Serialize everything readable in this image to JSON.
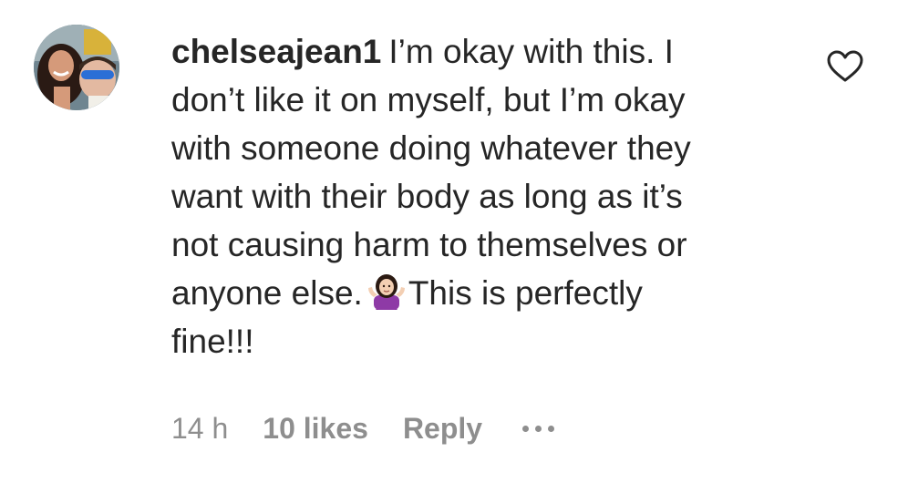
{
  "comment": {
    "username": "chelseajean1",
    "text_lines": [
      "I’m okay with this. I",
      "don’t like it on myself, but I’m okay",
      "with someone doing whatever they",
      "want with their body as long as it’s",
      "not causing harm to themselves or",
      "anyone else.",
      "This is perfectly",
      "fine!!!"
    ],
    "emoji": "person-shrugging-emoji",
    "timestamp": "14 h",
    "likes": "10 likes",
    "reply_label": "Reply",
    "more_icon": "more-options-icon",
    "like_icon": "heart-outline-icon"
  },
  "colors": {
    "text": "#262626",
    "secondary": "#8e8e8e"
  }
}
